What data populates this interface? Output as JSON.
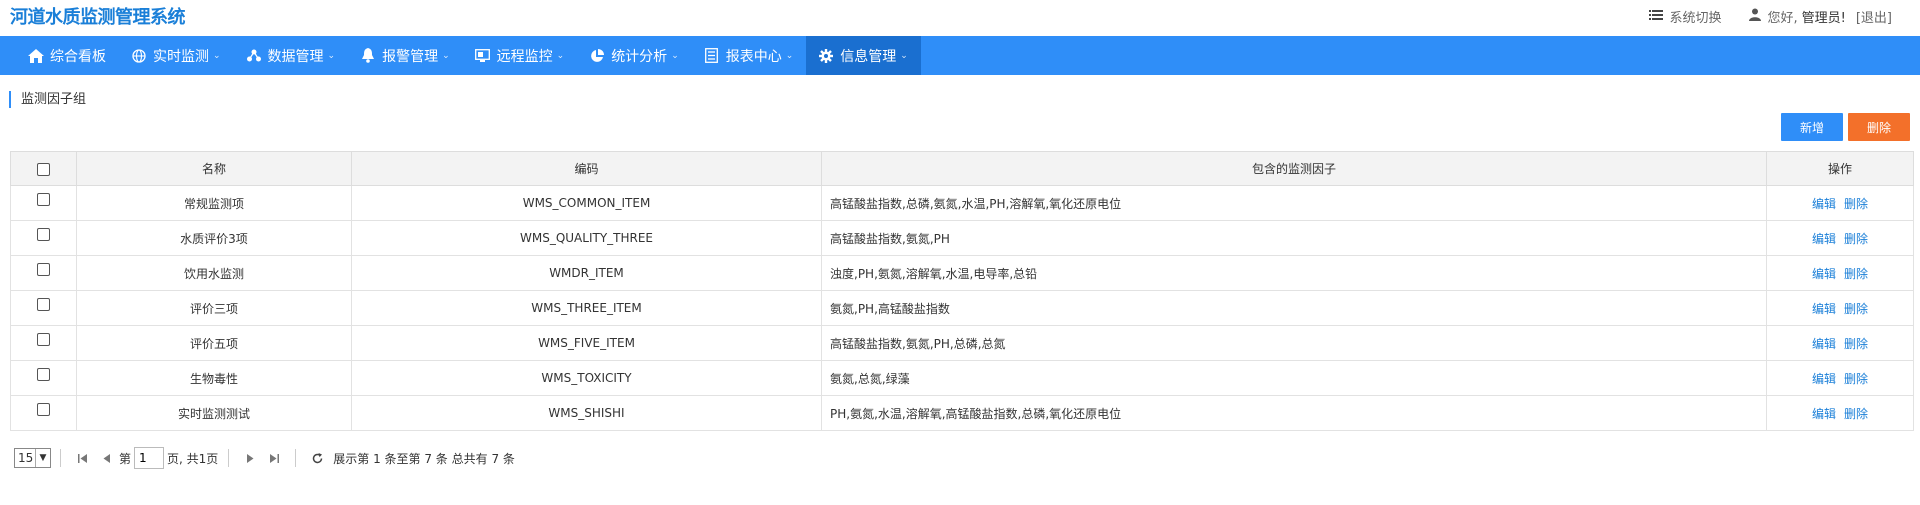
{
  "header": {
    "title": "河道水质监测管理系统",
    "switch_label": "系统切换",
    "greeting": "您好,",
    "user": "管理员!",
    "logout": "[退出]"
  },
  "nav": [
    {
      "label": "综合看板",
      "icon": "home-icon",
      "has_caret": false
    },
    {
      "label": "实时监测",
      "icon": "globe-icon",
      "has_caret": true
    },
    {
      "label": "数据管理",
      "icon": "sitemap-icon",
      "has_caret": true
    },
    {
      "label": "报警管理",
      "icon": "bell-icon",
      "has_caret": true
    },
    {
      "label": "远程监控",
      "icon": "monitor-icon",
      "has_caret": true
    },
    {
      "label": "统计分析",
      "icon": "pie-chart-icon",
      "has_caret": true
    },
    {
      "label": "报表中心",
      "icon": "document-icon",
      "has_caret": true
    },
    {
      "label": "信息管理",
      "icon": "gear-icon",
      "has_caret": true,
      "active": true
    }
  ],
  "section_title": "监测因子组",
  "toolbar": {
    "add_label": "新增",
    "delete_label": "删除"
  },
  "table": {
    "columns": [
      "名称",
      "编码",
      "包含的监测因子",
      "操作"
    ],
    "rows": [
      {
        "name": "常规监测项",
        "code": "WMS_COMMON_ITEM",
        "factors": "高锰酸盐指数,总磷,氨氮,水温,PH,溶解氧,氧化还原电位"
      },
      {
        "name": "水质评价3项",
        "code": "WMS_QUALITY_THREE",
        "factors": "高锰酸盐指数,氨氮,PH"
      },
      {
        "name": "饮用水监测",
        "code": "WMDR_ITEM",
        "factors": "浊度,PH,氨氮,溶解氧,水温,电导率,总铅"
      },
      {
        "name": "评价三项",
        "code": "WMS_THREE_ITEM",
        "factors": "氨氮,PH,高锰酸盐指数"
      },
      {
        "name": "评价五项",
        "code": "WMS_FIVE_ITEM",
        "factors": "高锰酸盐指数,氨氮,PH,总磷,总氮"
      },
      {
        "name": "生物毒性",
        "code": "WMS_TOXICITY",
        "factors": "氨氮,总氮,绿藻"
      },
      {
        "name": "实时监测测试",
        "code": "WMS_SHISHI",
        "factors": "PH,氨氮,水温,溶解氧,高锰酸盐指数,总磷,氧化还原电位"
      }
    ],
    "edit_label": "编辑",
    "delete_label": "删除"
  },
  "pager": {
    "page_size": "15",
    "page_prefix": "第",
    "current_page": "1",
    "page_suffix": "页, 共1页",
    "summary": "展示第 1 条至第 7 条 总共有 7 条"
  },
  "colors": {
    "primary": "#2f8ef8",
    "nav_active": "#1a6fd0",
    "danger": "#f3702a",
    "title": "#1a7fd8"
  }
}
